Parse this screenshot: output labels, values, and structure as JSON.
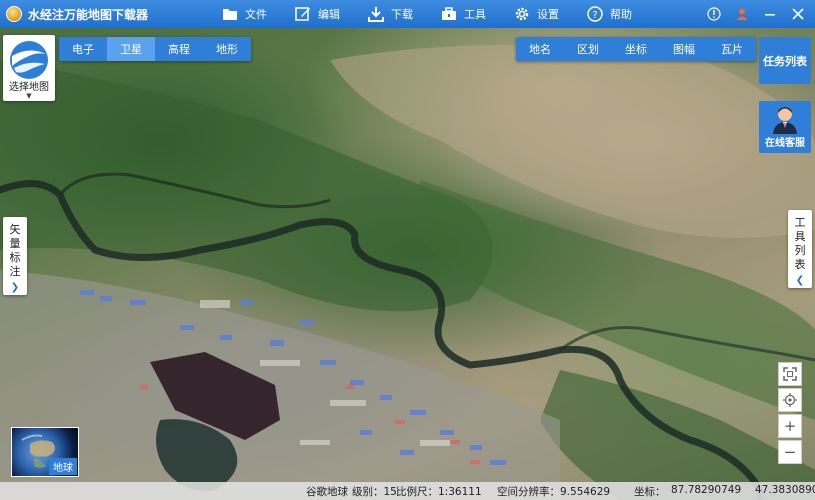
{
  "app": {
    "title": "水经注万能地图下载器"
  },
  "menu": [
    {
      "label": "文件",
      "icon": "folder-icon"
    },
    {
      "label": "编辑",
      "icon": "edit-icon"
    },
    {
      "label": "下载",
      "icon": "download-icon"
    },
    {
      "label": "工具",
      "icon": "toolbox-icon"
    },
    {
      "label": "设置",
      "icon": "gear-icon"
    },
    {
      "label": "帮助",
      "icon": "help-icon"
    }
  ],
  "window_controls": [
    "info-icon",
    "user-icon",
    "minimize-icon",
    "close-icon"
  ],
  "select_map": {
    "label": "选择地图"
  },
  "map_types": [
    {
      "label": "电子",
      "active": false
    },
    {
      "label": "卫星",
      "active": true
    },
    {
      "label": "高程",
      "active": false
    },
    {
      "label": "地形",
      "active": false
    }
  ],
  "overlay_tabs": [
    "地名",
    "区划",
    "坐标",
    "图幅",
    "瓦片"
  ],
  "task_list": {
    "label": "任务列表"
  },
  "service": {
    "label": "在线客服"
  },
  "left_panel": {
    "chars": [
      "矢",
      "量",
      "标",
      "注"
    ]
  },
  "right_panel": {
    "chars": [
      "工",
      "具",
      "列",
      "表"
    ]
  },
  "globe": {
    "label": "地球"
  },
  "status": {
    "source": "谷歌地球",
    "level": "级别：15",
    "scale": "比例尺：1:36111",
    "resolution": "空间分辨率：9.554629",
    "coord_label": "坐标：",
    "lon": "87.78290749",
    "lat": "47.3830890"
  },
  "colors": {
    "toolbar": "#1f6fce",
    "accent": "#2f7fd9"
  }
}
